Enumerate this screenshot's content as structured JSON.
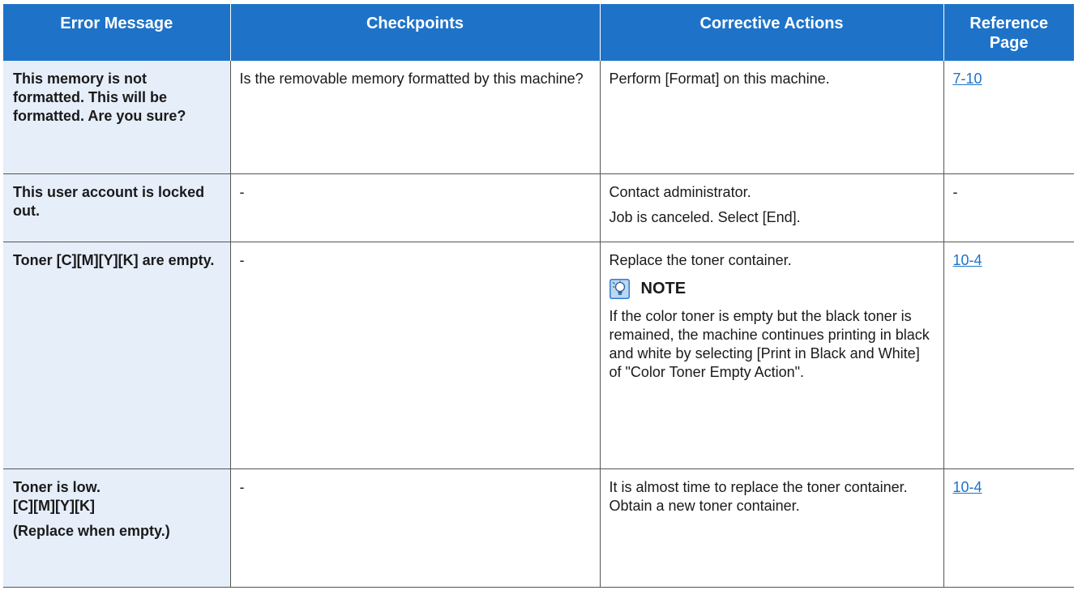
{
  "table": {
    "headers": [
      "Error Message",
      "Checkpoints",
      "Corrective Actions",
      "Reference Page"
    ],
    "rows": [
      {
        "error": [
          "This memory is not formatted. This will be formatted. Are you sure?"
        ],
        "checkpoint": "Is the removable memory formatted by this machine?",
        "actions": [
          "Perform [Format] on this machine."
        ],
        "reference": "7-10"
      },
      {
        "error": [
          "This user account is locked out."
        ],
        "checkpoint": "-",
        "actions": [
          "Contact administrator.",
          "Job is canceled. Select [End]."
        ],
        "reference": "-"
      },
      {
        "error": [
          "Toner [C][M][Y][K] are empty."
        ],
        "checkpoint": "-",
        "actions": [
          "Replace the toner container."
        ],
        "note": {
          "icon": "note-bulb-icon",
          "label": "NOTE",
          "text": " If the color toner is empty but the black toner is remained, the machine continues printing in black and white by selecting [Print in Black and White] of \"Color Toner Empty Action\"."
        },
        "reference": "10-4"
      },
      {
        "error": [
          "Toner is low.",
          "[C][M][Y][K]",
          "(Replace when empty.)"
        ],
        "checkpoint": "-",
        "actions": [
          "It is almost time to replace the toner container. Obtain a new toner container."
        ],
        "reference": "10-4"
      }
    ]
  },
  "colors": {
    "header_bg": "#1e73c8",
    "first_col_bg": "#e6eefa",
    "link": "#1e73c8"
  }
}
